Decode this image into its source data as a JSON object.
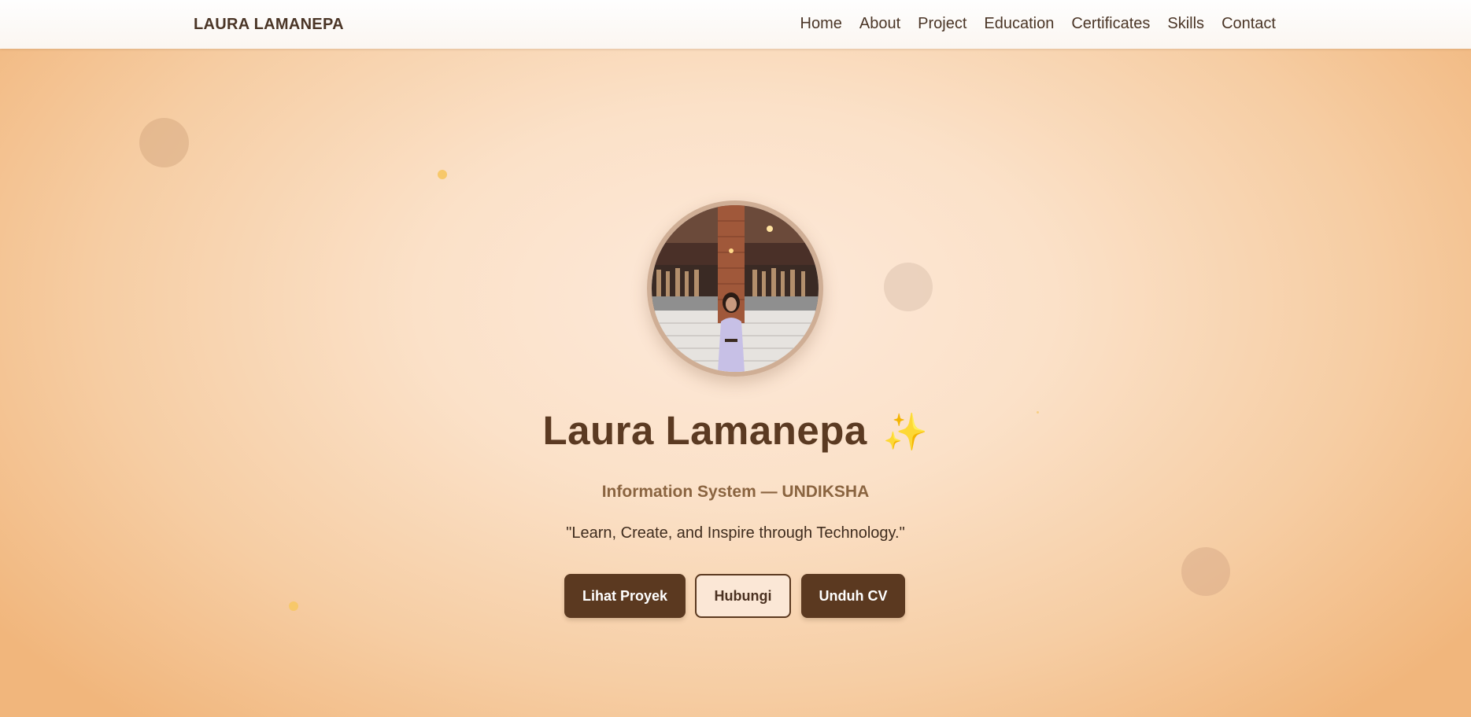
{
  "header": {
    "brand": "LAURA LAMANEPA",
    "nav": [
      "Home",
      "About",
      "Project",
      "Education",
      "Certificates",
      "Skills",
      "Contact"
    ]
  },
  "hero": {
    "name": "Laura Lamanepa",
    "sparkle_icon": "sparkles-icon",
    "sparkle_glyph": "✨",
    "subtitle": "Information System — UNDIKSHA",
    "quote": "\"Learn, Create, and Inspire through Technology.\"",
    "buttons": {
      "projects": "Lihat Proyek",
      "contact": "Hubungi",
      "cv": "Unduh CV"
    }
  },
  "colors": {
    "accent": "#5b3920",
    "title": "#5b3a22",
    "subtitle": "#8a6440",
    "sparkle": "#f5a531"
  }
}
